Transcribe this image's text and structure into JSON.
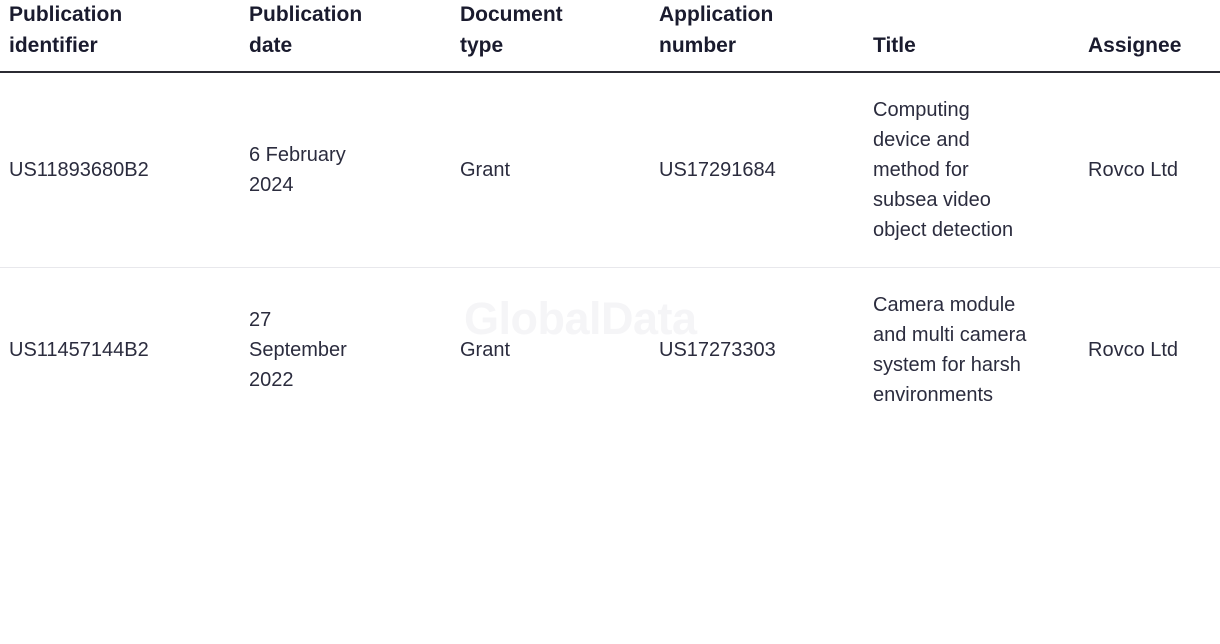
{
  "watermark": {
    "text": "GlobalData",
    "color": "#f5f5f7"
  },
  "colors": {
    "page_background": "#ffffff",
    "header_text": "#1a1b2e",
    "body_text": "#2b2c3e",
    "header_rule": "#2b2b33",
    "row_rule": "#e8e8ec"
  },
  "table": {
    "columns": [
      {
        "key": "publication_identifier",
        "label": "Publication identifier"
      },
      {
        "key": "publication_date",
        "label": "Publication date"
      },
      {
        "key": "document_type",
        "label": "Document type"
      },
      {
        "key": "application_number",
        "label": "Application number"
      },
      {
        "key": "title",
        "label": "Title"
      },
      {
        "key": "assignee",
        "label": "Assignee"
      }
    ],
    "rows": [
      {
        "publication_identifier": "US11893680B2",
        "publication_date": "6 February 2024",
        "document_type": "Grant",
        "application_number": "US17291684",
        "title": "Computing device and method for subsea video object detection",
        "assignee": "Rovco Ltd"
      },
      {
        "publication_identifier": "US11457144B2",
        "publication_date": "27 September 2022",
        "document_type": "Grant",
        "application_number": "US17273303",
        "title": "Camera module and multi camera system for harsh environments",
        "assignee": "Rovco Ltd"
      }
    ]
  }
}
